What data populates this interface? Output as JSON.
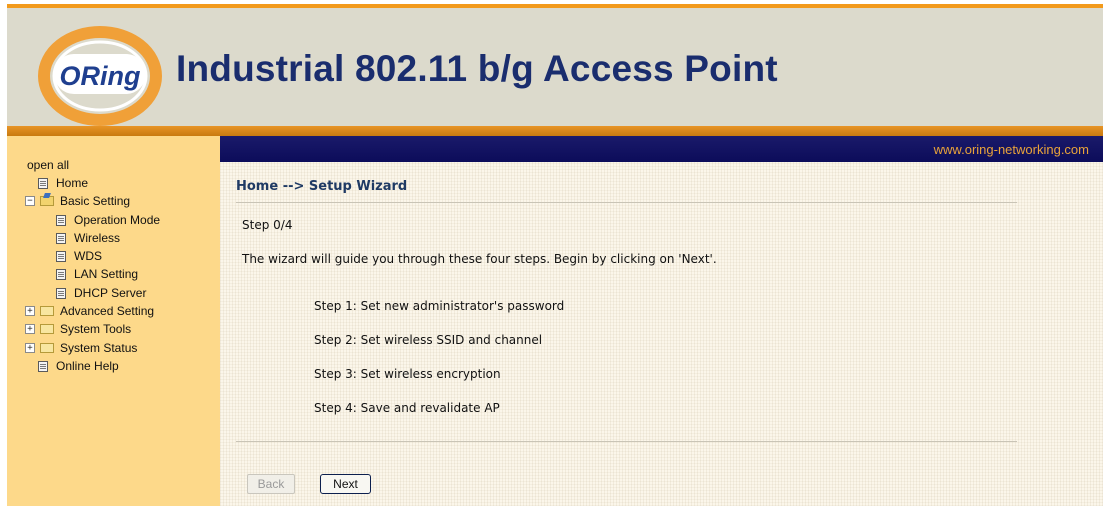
{
  "header": {
    "title": "Industrial 802.11 b/g Access Point",
    "logo_text": "ORing",
    "url": "www.oring-networking.com"
  },
  "sidebar": {
    "open_all": "open all",
    "items": [
      {
        "label": "Home",
        "icon": "page-icon"
      },
      {
        "label": "Basic Setting",
        "icon": "folder-open-icon",
        "toggle": "−"
      },
      {
        "label": "Operation Mode",
        "icon": "page-icon"
      },
      {
        "label": "Wireless",
        "icon": "page-icon"
      },
      {
        "label": "WDS",
        "icon": "page-icon"
      },
      {
        "label": "LAN Setting",
        "icon": "page-icon"
      },
      {
        "label": "DHCP Server",
        "icon": "page-icon"
      },
      {
        "label": "Advanced Setting",
        "icon": "folder-icon",
        "toggle": "+"
      },
      {
        "label": "System Tools",
        "icon": "folder-icon",
        "toggle": "+"
      },
      {
        "label": "System Status",
        "icon": "folder-icon",
        "toggle": "+"
      },
      {
        "label": "Online Help",
        "icon": "page-icon"
      }
    ]
  },
  "main": {
    "breadcrumb": "Home --> Setup Wizard",
    "step_indicator": "Step 0/4",
    "intro": "The wizard will guide you through these four steps. Begin by clicking on 'Next'.",
    "steps": [
      "Step 1: Set new administrator's password",
      "Step 2: Set wireless SSID and channel",
      "Step 3: Set wireless encryption",
      "Step 4: Save and revalidate AP"
    ],
    "back_label": "Back",
    "next_label": "Next"
  },
  "colors": {
    "header_accent": "#f29a1c",
    "title": "#1a2d6e",
    "sidebar_bg": "#fdd98a",
    "topbar": "#0c0c5a",
    "url": "#e9a33a"
  }
}
